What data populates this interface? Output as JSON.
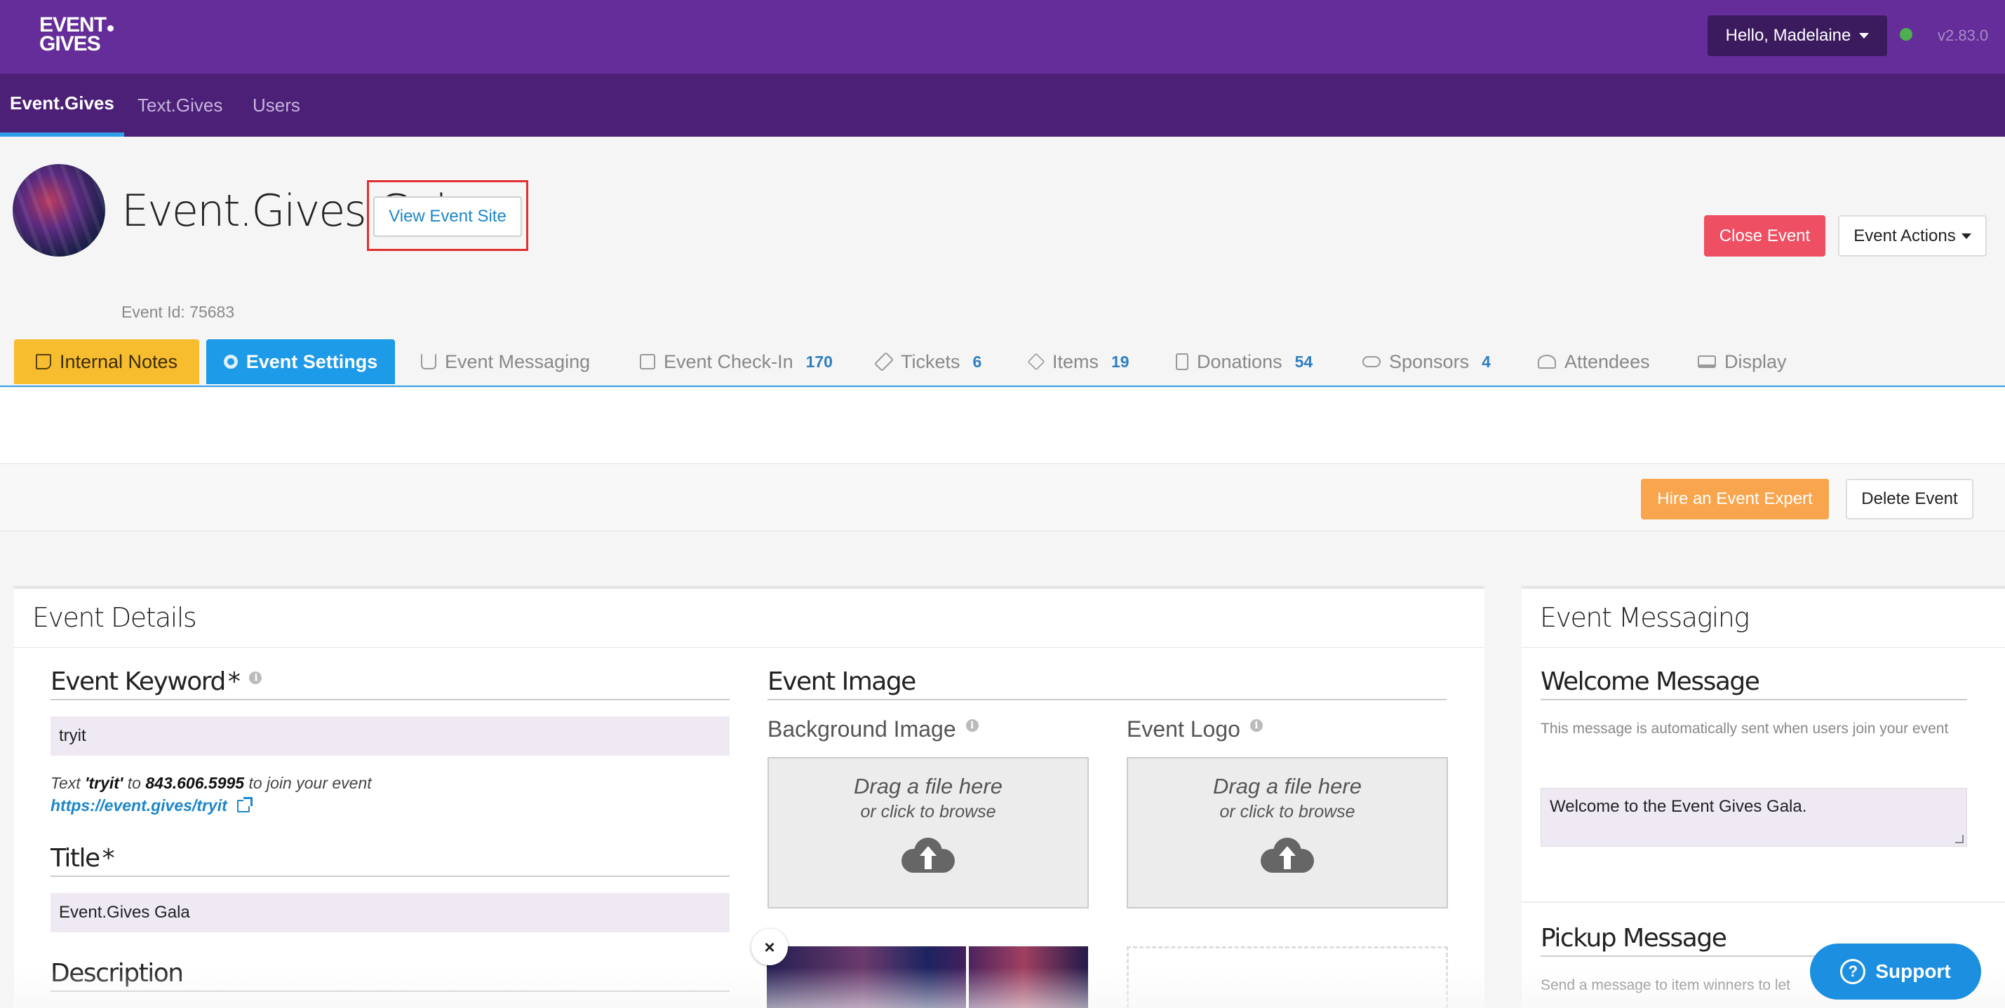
{
  "app": {
    "logo_line1": "EVENT",
    "logo_line2": "GIVES",
    "version": "v2.83.0",
    "user_menu_label": "Hello,  Madelaine",
    "status_color": "#4caf50",
    "brand_color": "#652d99"
  },
  "nav": {
    "items": [
      {
        "label": "Event.Gives",
        "active": true
      },
      {
        "label": "Text.Gives",
        "active": false
      },
      {
        "label": "Users",
        "active": false
      }
    ]
  },
  "event": {
    "title": "Event.Gives Gala",
    "id_label": "Event Id: 75683",
    "view_site_label": "View Event Site",
    "close_label": "Close Event",
    "actions_label": "Event Actions"
  },
  "tabs": [
    {
      "label": "Internal Notes",
      "count": "",
      "icon": "note-icon"
    },
    {
      "label": "Event Settings",
      "count": "",
      "icon": "gear-icon"
    },
    {
      "label": "Event Messaging",
      "count": "",
      "icon": "inbox-icon"
    },
    {
      "label": "Event Check-In",
      "count": "170",
      "icon": "clipboard-icon"
    },
    {
      "label": "Tickets",
      "count": "6",
      "icon": "ticket-icon"
    },
    {
      "label": "Items",
      "count": "19",
      "icon": "layers-icon"
    },
    {
      "label": "Donations",
      "count": "54",
      "icon": "receipt-icon"
    },
    {
      "label": "Sponsors",
      "count": "4",
      "icon": "handshake-icon"
    },
    {
      "label": "Attendees",
      "count": "",
      "icon": "users-icon"
    },
    {
      "label": "Display",
      "count": "",
      "icon": "monitor-icon"
    }
  ],
  "actions": {
    "hire_label": "Hire an Event Expert",
    "delete_label": "Delete Event"
  },
  "details": {
    "heading": "Event Details",
    "keyword_label": "Event Keyword",
    "required_mark": "*",
    "keyword_value": "tryit",
    "help_prefix": "Text ",
    "help_keyword": "'tryit'",
    "help_mid": " to ",
    "help_number": "843.606.5995",
    "help_suffix": " to join your event",
    "event_link": "https://event.gives/tryit",
    "title_label": "Title",
    "title_value": "Event.Gives Gala",
    "description_label": "Description",
    "image_label": "Event Image",
    "background_label": "Background Image",
    "logo_label": "Event Logo",
    "drop_line1": "Drag a file here",
    "drop_line2": "or click to browse",
    "remove_symbol": "×"
  },
  "messaging": {
    "heading": "Event Messaging",
    "welcome_label": "Welcome Message",
    "welcome_desc": "This message is automatically sent when users join your event",
    "welcome_value": "Welcome to the Event Gives Gala.",
    "pickup_label": "Pickup Message",
    "pickup_desc": "Send a message to item winners to let"
  },
  "support": {
    "label": "Support",
    "icon_glyph": "?"
  }
}
